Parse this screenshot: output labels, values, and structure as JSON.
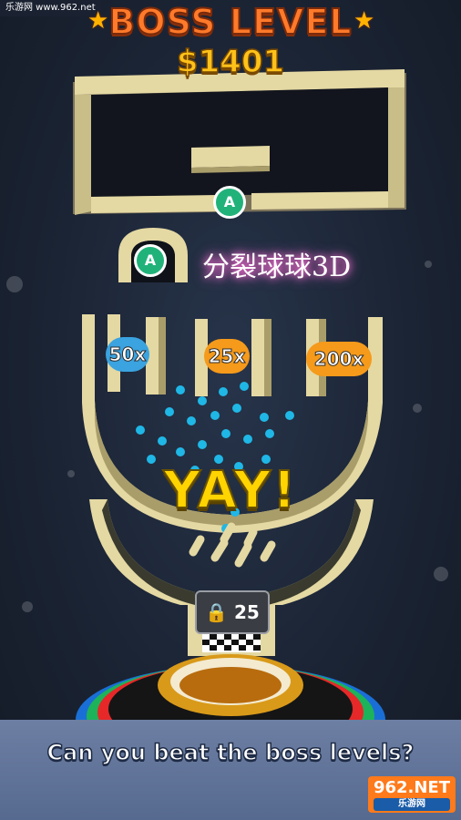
{
  "watermark_top": "乐游网 www.962.net",
  "header": {
    "title": "BOSS LEVEL",
    "money": "$1401"
  },
  "badges": {
    "gate_a": "A",
    "pipe_a": "A"
  },
  "overlay_title": "分裂球球3D",
  "multipliers": [
    {
      "label": "50x",
      "color": "#3aa3e0"
    },
    {
      "label": "25x",
      "color": "#f59a1a"
    },
    {
      "label": "200x",
      "color": "#f59a1a"
    }
  ],
  "yay": "YAY!",
  "lock": {
    "count": "25",
    "icon": "lock-icon"
  },
  "caption": "Can you beat the boss levels?",
  "watermark_logo": {
    "brand": "962.NET",
    "sub": "乐游网"
  },
  "colors": {
    "wall": "#e4d8a3",
    "ball": "#1fb7e6",
    "badge": "#21b27a"
  }
}
